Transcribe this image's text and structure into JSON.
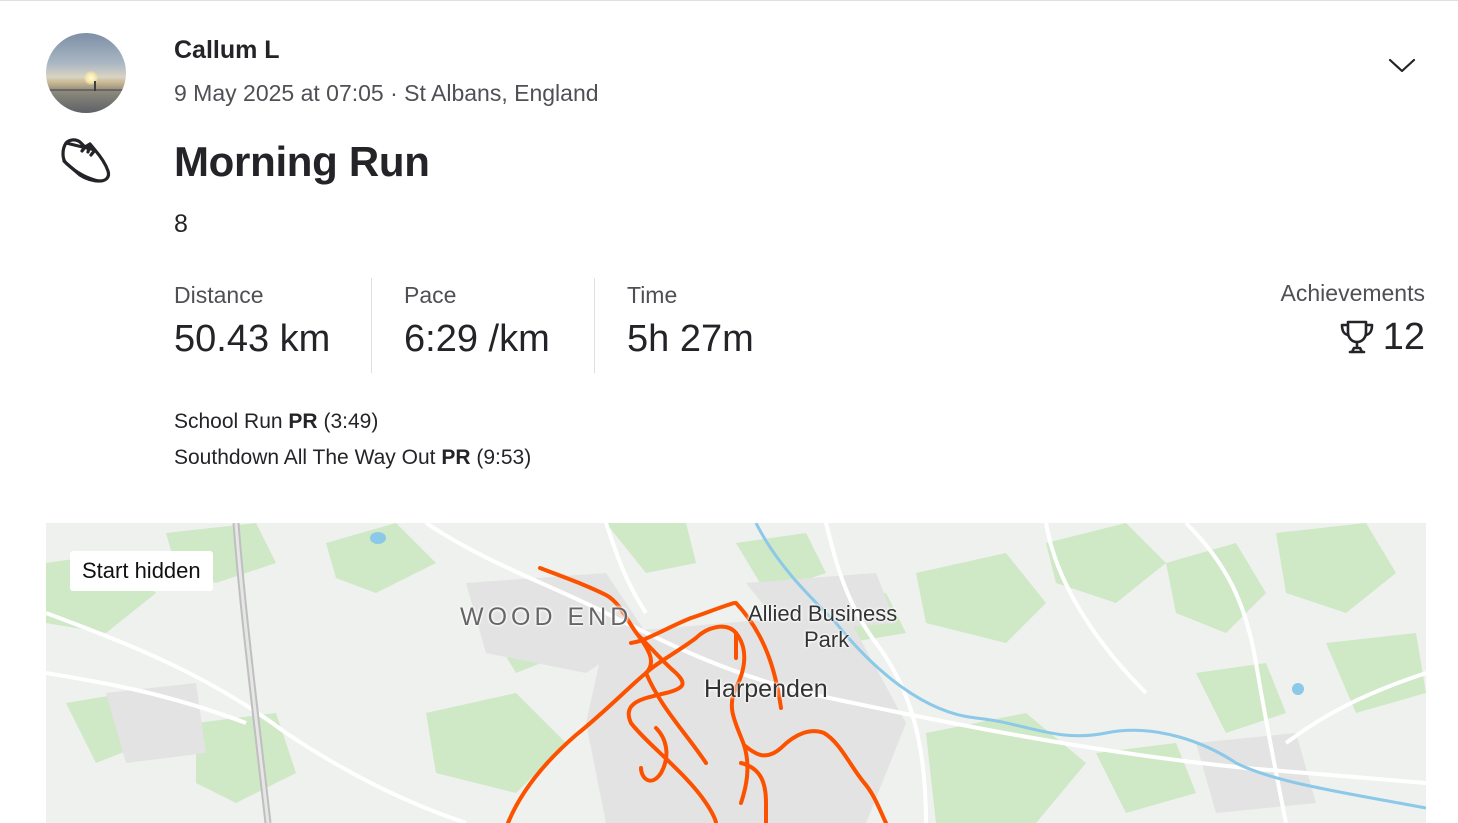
{
  "athlete": {
    "name": "Callum L"
  },
  "activity": {
    "datetime": "9 May 2025 at 07:05",
    "location": "St Albans, England",
    "title": "Morning Run",
    "description": "8",
    "sport_icon": "running-shoe-icon"
  },
  "stats": [
    {
      "label": "Distance",
      "value": "50.43 km"
    },
    {
      "label": "Pace",
      "value": "6:29 /km"
    },
    {
      "label": "Time",
      "value": "5h 27m"
    }
  ],
  "achievements": {
    "label": "Achievements",
    "count": "12",
    "icon": "trophy-icon"
  },
  "segments": [
    {
      "name": "School Run",
      "badge": "PR",
      "time": "(3:49)"
    },
    {
      "name": "Southdown All The Way Out",
      "badge": "PR",
      "time": "(9:53)"
    }
  ],
  "map": {
    "start_label": "Start hidden",
    "places": [
      "WOOD END",
      "Allied Business",
      "Park",
      "Harpenden"
    ],
    "route_color": "#fc5200"
  },
  "colors": {
    "text": "#242428",
    "muted": "#4f4f55",
    "route": "#fc5200",
    "map_bg": "#eef1ee",
    "green": "#c8e6c0"
  }
}
